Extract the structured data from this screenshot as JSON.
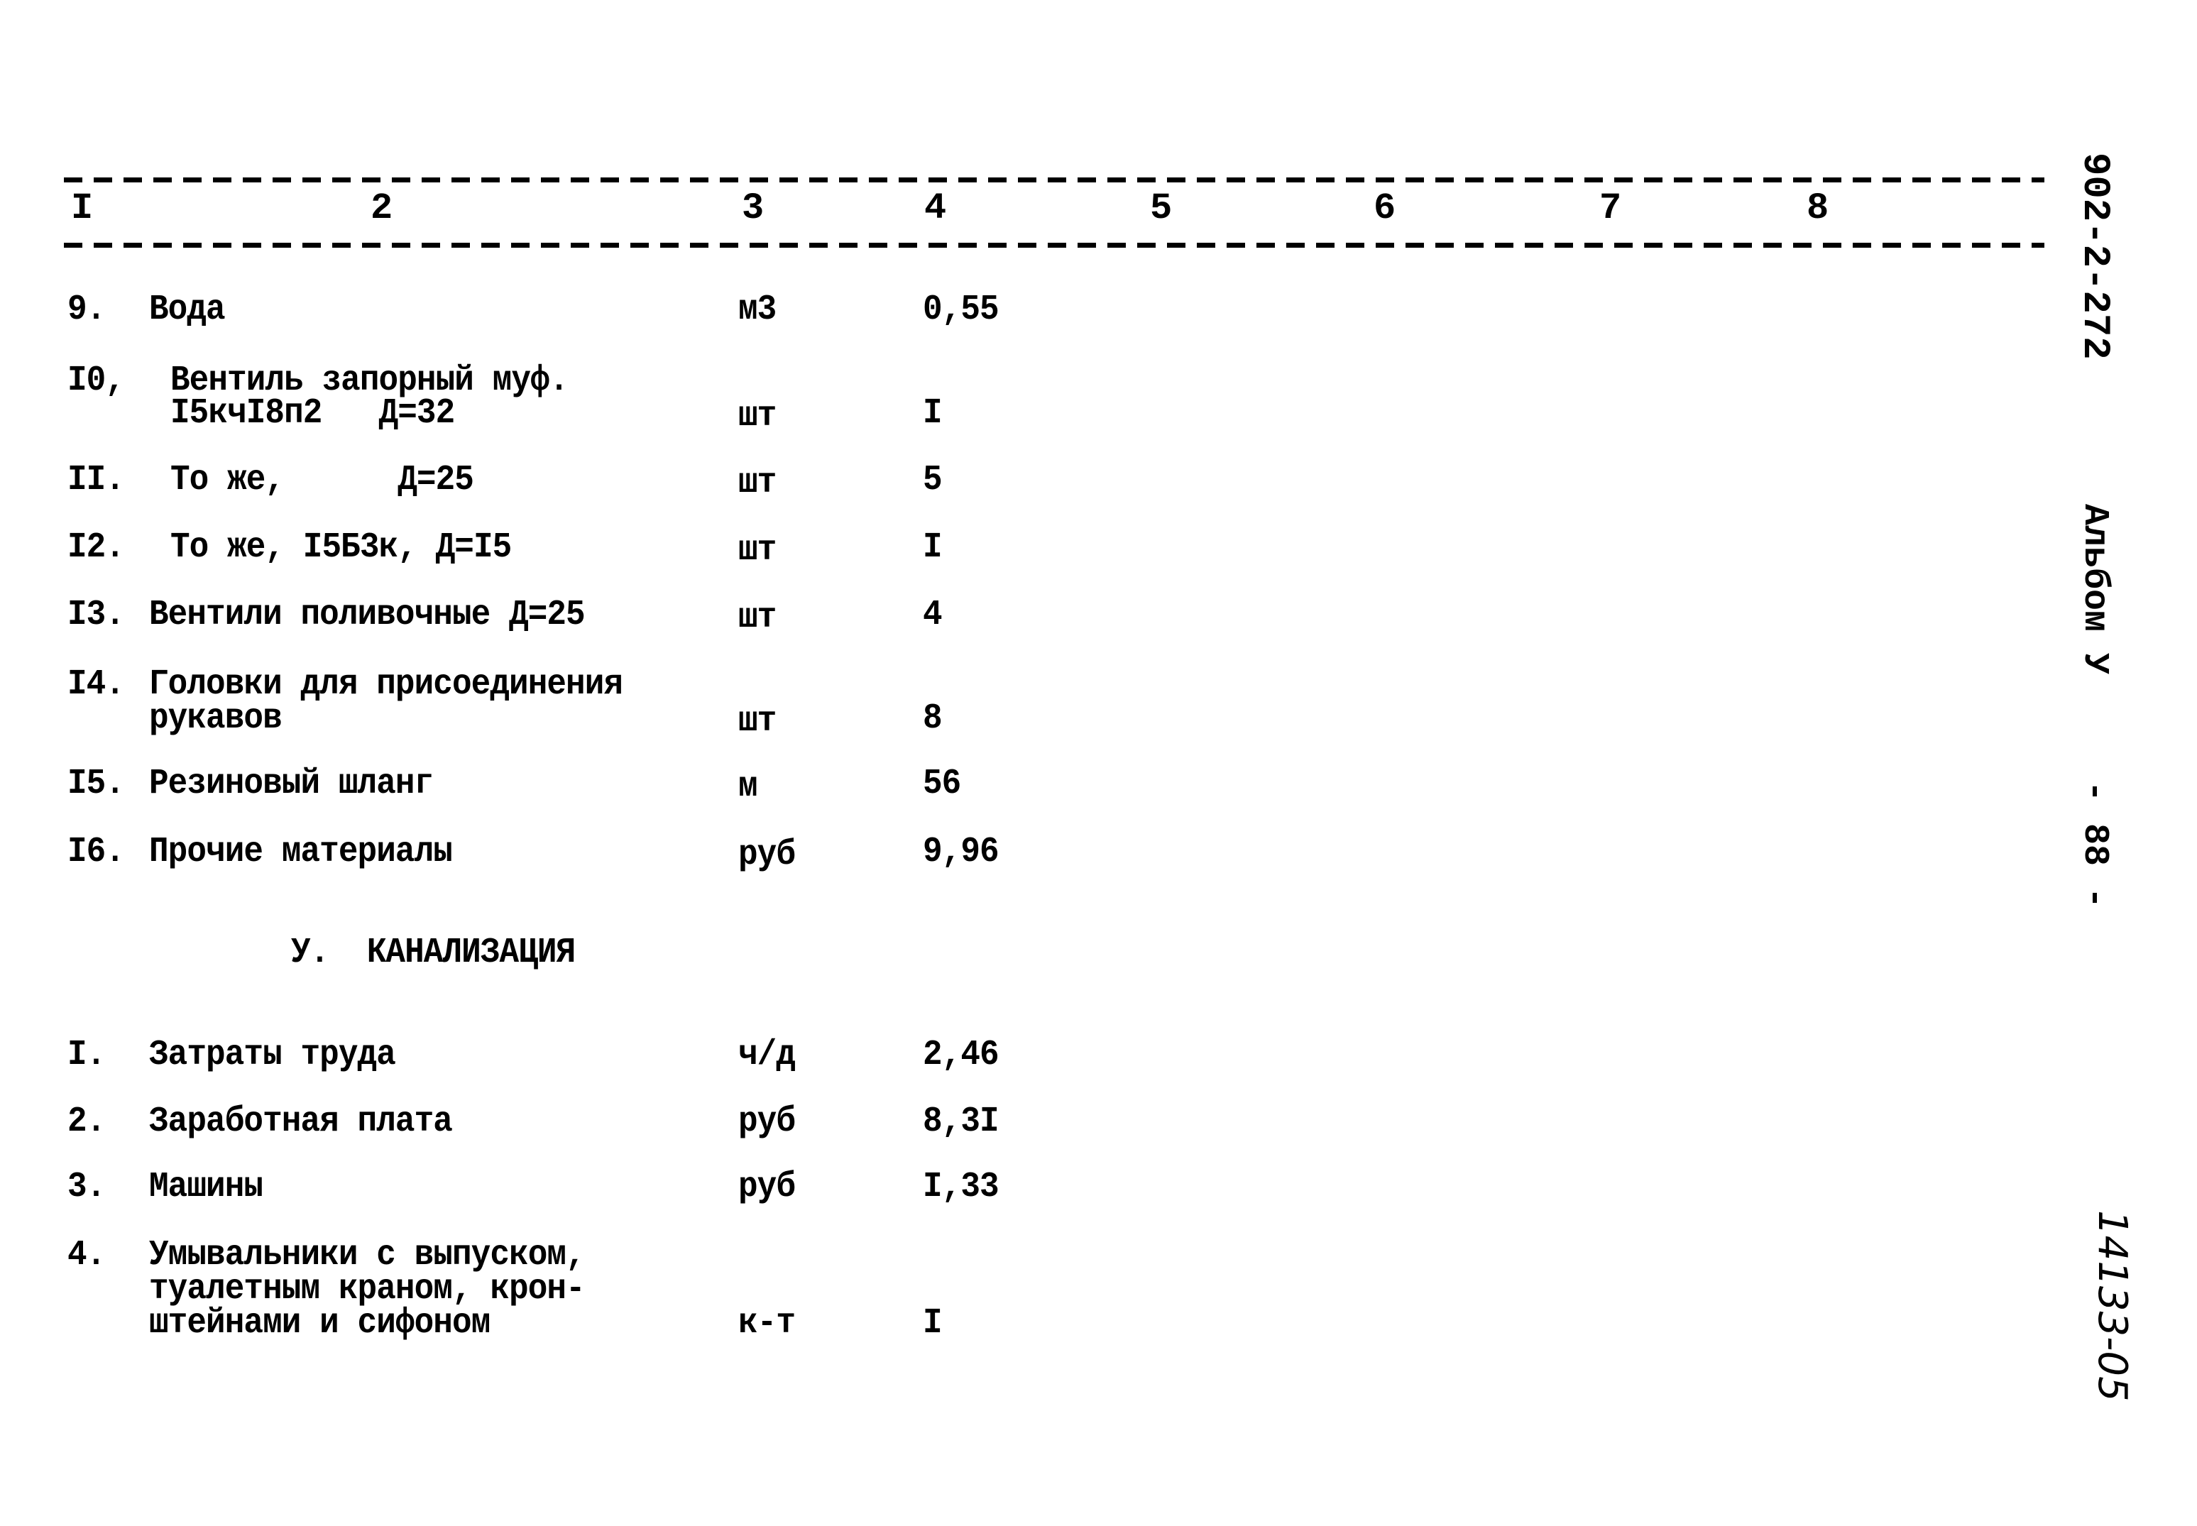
{
  "header": {
    "columns": [
      "I",
      "2",
      "3",
      "4",
      "5",
      "6",
      "7",
      "8"
    ]
  },
  "rows_part1": [
    {
      "num": "9.",
      "name": [
        "Вода"
      ],
      "unit": "м3",
      "value": "0,55"
    },
    {
      "num": "I0,",
      "name": [
        "Вентиль запорный муф.",
        "I5кчI8п2   Д=32"
      ],
      "unit": "шт",
      "value": "I"
    },
    {
      "num": "II.",
      "name": [
        "То же,      Д=25"
      ],
      "unit": "шт",
      "value": "5"
    },
    {
      "num": "I2.",
      "name": [
        "То же, I5Б3к, Д=I5"
      ],
      "unit": "шт",
      "value": "I"
    },
    {
      "num": "I3.",
      "name": [
        "Вентили поливочные Д=25"
      ],
      "unit": "шт",
      "value": "4"
    },
    {
      "num": "I4.",
      "name": [
        "Головки для присоединения",
        "рукавов"
      ],
      "unit": "шт",
      "value": "8"
    },
    {
      "num": "I5.",
      "name": [
        "Резиновый шланг"
      ],
      "unit": "м",
      "value": "56"
    },
    {
      "num": "I6.",
      "name": [
        "Прочие материалы"
      ],
      "unit": "руб",
      "value": "9,96"
    }
  ],
  "section_title": "У.  КАНАЛИЗАЦИЯ",
  "rows_part2": [
    {
      "num": "I.",
      "name": [
        "Затраты труда"
      ],
      "unit": "ч/д",
      "value": "2,46"
    },
    {
      "num": "2.",
      "name": [
        "Заработная плата"
      ],
      "unit": "руб",
      "value": "8,3I"
    },
    {
      "num": "3.",
      "name": [
        "Машины"
      ],
      "unit": "руб",
      "value": "I,33"
    },
    {
      "num": "4.",
      "name": [
        "Умывальники с выпуском,",
        "туалетным краном, крон-",
        "штейнами и сифоном"
      ],
      "unit": "к-т",
      "value": "I"
    }
  ],
  "margin": {
    "doc_code": "902-2-272",
    "album": "Альбом У",
    "page": "- 88 -",
    "handwritten_code": "14133-05"
  }
}
